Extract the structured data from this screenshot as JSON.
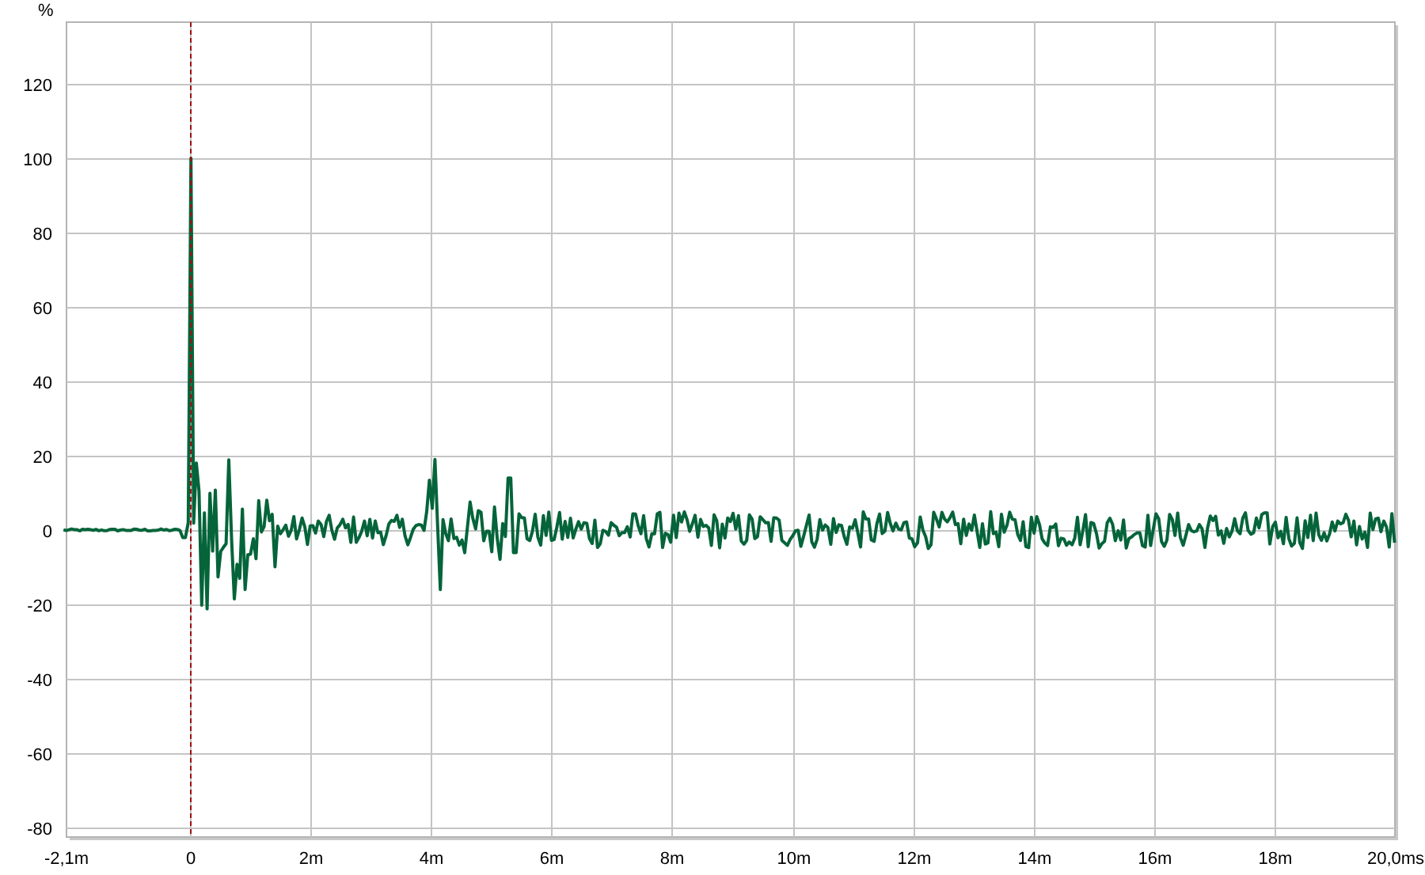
{
  "chart": {
    "y_unit": "%",
    "y_tick_labels": [
      "120",
      "100",
      "80",
      "60",
      "40",
      "20",
      "0",
      "-20",
      "-40",
      "-60",
      "-80"
    ],
    "x_tick_labels": [
      "-2,1m",
      "0",
      "2m",
      "4m",
      "6m",
      "8m",
      "10m",
      "12m",
      "14m",
      "16m",
      "18m",
      "20,0ms"
    ]
  }
}
